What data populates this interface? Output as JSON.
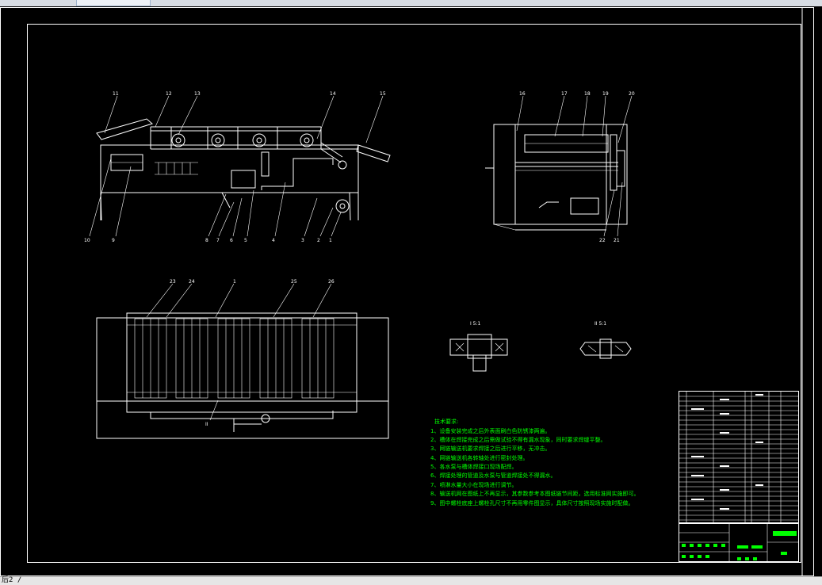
{
  "drawing": {
    "balloons_front": [
      "11",
      "12",
      "13",
      "14",
      "15",
      "10",
      "9",
      "8",
      "7",
      "6",
      "5",
      "4",
      "3",
      "2",
      "1"
    ],
    "balloons_side": [
      "16",
      "17",
      "18",
      "19",
      "20",
      "22",
      "21"
    ],
    "balloons_top": [
      "23",
      "24",
      "1",
      "25",
      "26"
    ],
    "section_label": "II",
    "detail_1": "I 5:1",
    "detail_2": "II 5:1"
  },
  "notes": {
    "title": "技术要求:",
    "items": [
      "1、设备安装完成之后外表面刷白色防锈漆两遍。",
      "2、槽体在焊接完成之后需做试验不得有漏水现象，同时要求焊缝平整。",
      "3、网链输送机要求焊接之后进行平移，无冲击。",
      "4、网链输送机各转轴处进行密封处理。",
      "5、各水泵与槽体焊接口现场配焊。",
      "6、焊接处理的管道及水泵与管道焊接处不得漏水。",
      "7、喷淋水量大小在现场进行调节。",
      "8、输送机网在图纸上不再显示，其参数参考本图纸链节间距，选用标准网实施即可。",
      "9、图中螺栓底座上螺栓孔尺寸不再用零件图显示，具体尺寸按照现场实施时配做。"
    ]
  },
  "statusbar": {
    "command_text": "后2 /"
  },
  "colors": {
    "background": "#000000",
    "lines": "#ffffff",
    "annotation": "#00ff00"
  }
}
